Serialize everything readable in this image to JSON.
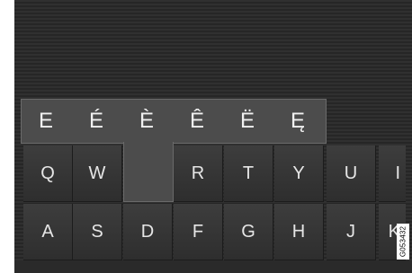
{
  "accent_popup": {
    "keys": [
      "E",
      "É",
      "È",
      "Ê",
      "Ë",
      "Ę"
    ]
  },
  "keyboard": {
    "row1": [
      "Q",
      "W",
      "E",
      "R",
      "T",
      "Y",
      "U",
      "I"
    ],
    "row2": [
      "A",
      "S",
      "D",
      "F",
      "G",
      "H",
      "J",
      "K"
    ],
    "pressed_key": "E"
  },
  "figure_id": "G053432"
}
